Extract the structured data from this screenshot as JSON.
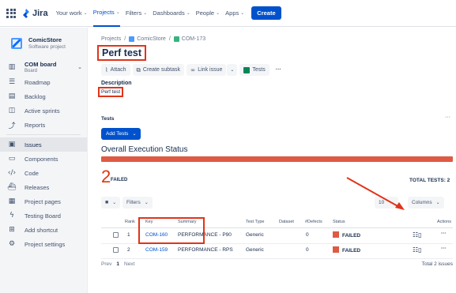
{
  "topnav": {
    "logo": "Jira",
    "items": [
      {
        "label": "Your work",
        "chev": "⌄"
      },
      {
        "label": "Projects",
        "chev": "⌄"
      },
      {
        "label": "Filters",
        "chev": "⌄"
      },
      {
        "label": "Dashboards",
        "chev": "⌄"
      },
      {
        "label": "People",
        "chev": "⌄"
      },
      {
        "label": "Apps",
        "chev": "⌄"
      }
    ],
    "create": "Create",
    "colors": {
      "brand": "#0052cc",
      "jira_blue": "#2684ff"
    }
  },
  "sidebar": {
    "project_name": "ComicStore",
    "project_type": "Software project",
    "board_name": "COM board",
    "board_sub": "Board",
    "items": [
      {
        "label": "Roadmap",
        "icon": "roadmap-icon"
      },
      {
        "label": "Backlog",
        "icon": "backlog-icon"
      },
      {
        "label": "Active sprints",
        "icon": "sprints-icon"
      },
      {
        "label": "Reports",
        "icon": "reports-icon"
      },
      {
        "label": "Issues",
        "icon": "issues-icon"
      },
      {
        "label": "Components",
        "icon": "components-icon"
      },
      {
        "label": "Code",
        "icon": "code-icon"
      },
      {
        "label": "Releases",
        "icon": "releases-icon"
      },
      {
        "label": "Project pages",
        "icon": "pages-icon"
      },
      {
        "label": "Testing Board",
        "icon": "testing-board-icon"
      },
      {
        "label": "Add shortcut",
        "icon": "add-shortcut-icon"
      },
      {
        "label": "Project settings",
        "icon": "settings-icon"
      }
    ],
    "active_item": "Issues"
  },
  "main": {
    "breadcrumb": [
      "Projects",
      "ComicStore",
      "COM-173"
    ],
    "title": "Perf test",
    "actions": [
      "Attach",
      "Create subtask",
      "Link issue",
      "Tests"
    ],
    "description_label": "Description",
    "description": "Perf test",
    "tests_label": "Tests",
    "tests_more": "···",
    "add_tests": "Add Tests",
    "overall_title": "Overall Execution Status",
    "failed_count": "2",
    "failed_label": "FAILED",
    "total_tests": "TOTAL TESTS: 2",
    "filters_label": "Filters",
    "page_size": "10",
    "columns_label": "Columns",
    "columns": {
      "rank": "Rank",
      "key": "Key",
      "summary": "Summary",
      "test_type": "Test Type",
      "dataset": "Dataset",
      "defects": "#Defects",
      "status": "Status",
      "actions": "Actions"
    },
    "rows": [
      {
        "rank": "1",
        "key": "COM-160",
        "summary": "PERFORMANCE - P90",
        "test_type": "Generic",
        "defects": "0",
        "status": "FAILED"
      },
      {
        "rank": "2",
        "key": "COM-159",
        "summary": "PERFORMANCE - RPS",
        "test_type": "Generic",
        "defects": "0",
        "status": "FAILED"
      }
    ],
    "pager": {
      "prev": "Prev",
      "current": "1",
      "next": "Next",
      "total": "Total 2 issues"
    },
    "colors": {
      "failed": "#de5a43",
      "annotation": "#e0341a"
    }
  }
}
